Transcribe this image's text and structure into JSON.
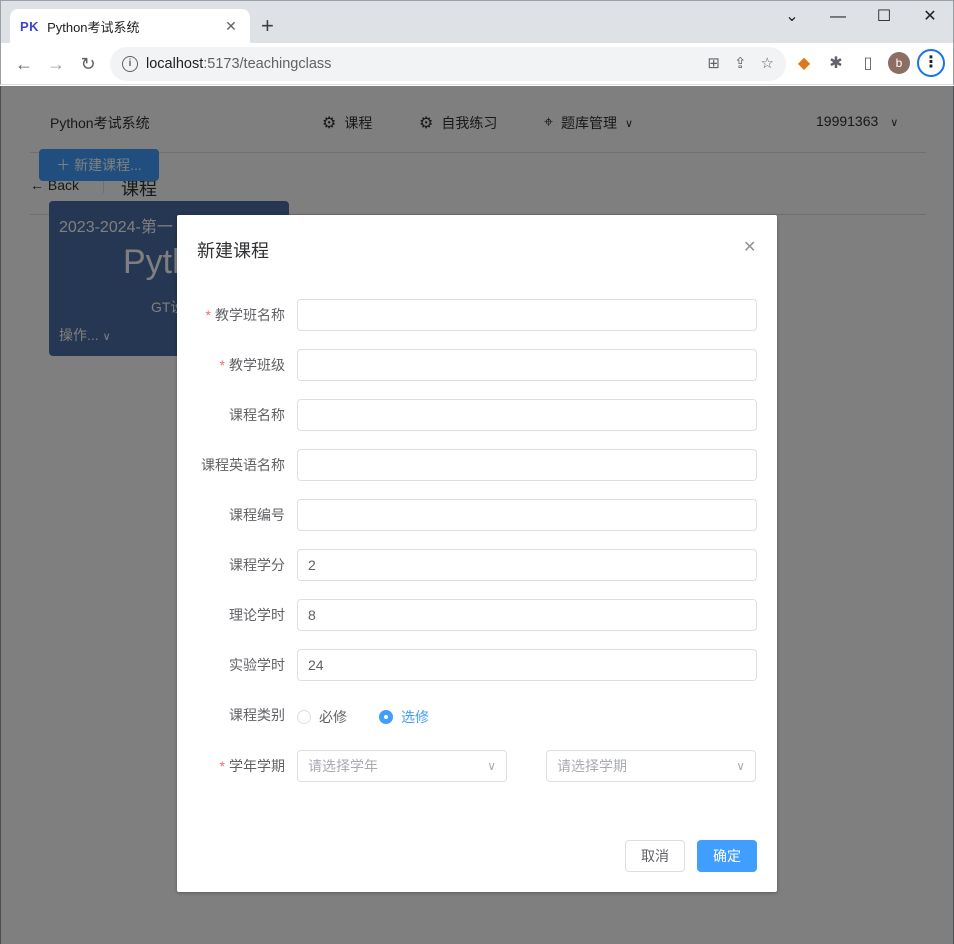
{
  "browser": {
    "tab_favicon": "PK",
    "tab_title": "Python考试系统",
    "url_host": "localhost",
    "url_rest": ":5173/teachingclass",
    "colors": {
      "tabstrip": "#dee1e6",
      "focus_ring": "#1a73e8"
    },
    "profile_initial": "b"
  },
  "app": {
    "brand": "Python考试系统",
    "menu": [
      {
        "label": "课程",
        "icon": "gear-icon"
      },
      {
        "label": "自我练习",
        "icon": "gear-icon"
      },
      {
        "label": "题库管理",
        "icon": "location-pin-icon"
      }
    ],
    "user": "19991363",
    "back_label": "Back",
    "page_title": "课程",
    "new_course_label": "新建课程...",
    "card": {
      "term": "2023-2024-第一",
      "name": "Pyth",
      "subtitle": "GT设",
      "ops_label": "操作..."
    }
  },
  "dialog": {
    "title": "新建课程",
    "fields": [
      {
        "label": "教学班名称",
        "required": true,
        "value": ""
      },
      {
        "label": "教学班级",
        "required": true,
        "value": ""
      },
      {
        "label": "课程名称",
        "required": false,
        "value": ""
      },
      {
        "label": "课程英语名称",
        "required": false,
        "value": ""
      },
      {
        "label": "课程编号",
        "required": false,
        "value": ""
      },
      {
        "label": "课程学分",
        "required": false,
        "value": "2"
      },
      {
        "label": "理论学时",
        "required": false,
        "value": "8"
      },
      {
        "label": "实验学时",
        "required": false,
        "value": "24"
      }
    ],
    "category": {
      "label": "课程类别",
      "options": [
        "必修",
        "选修"
      ],
      "selected": "选修"
    },
    "term": {
      "label": "学年学期",
      "required": true,
      "year_placeholder": "请选择学年",
      "semester_placeholder": "请选择学期"
    },
    "cancel_label": "取消",
    "ok_label": "确定",
    "accent_color": "#409eff",
    "required_color": "#f56c6c"
  }
}
